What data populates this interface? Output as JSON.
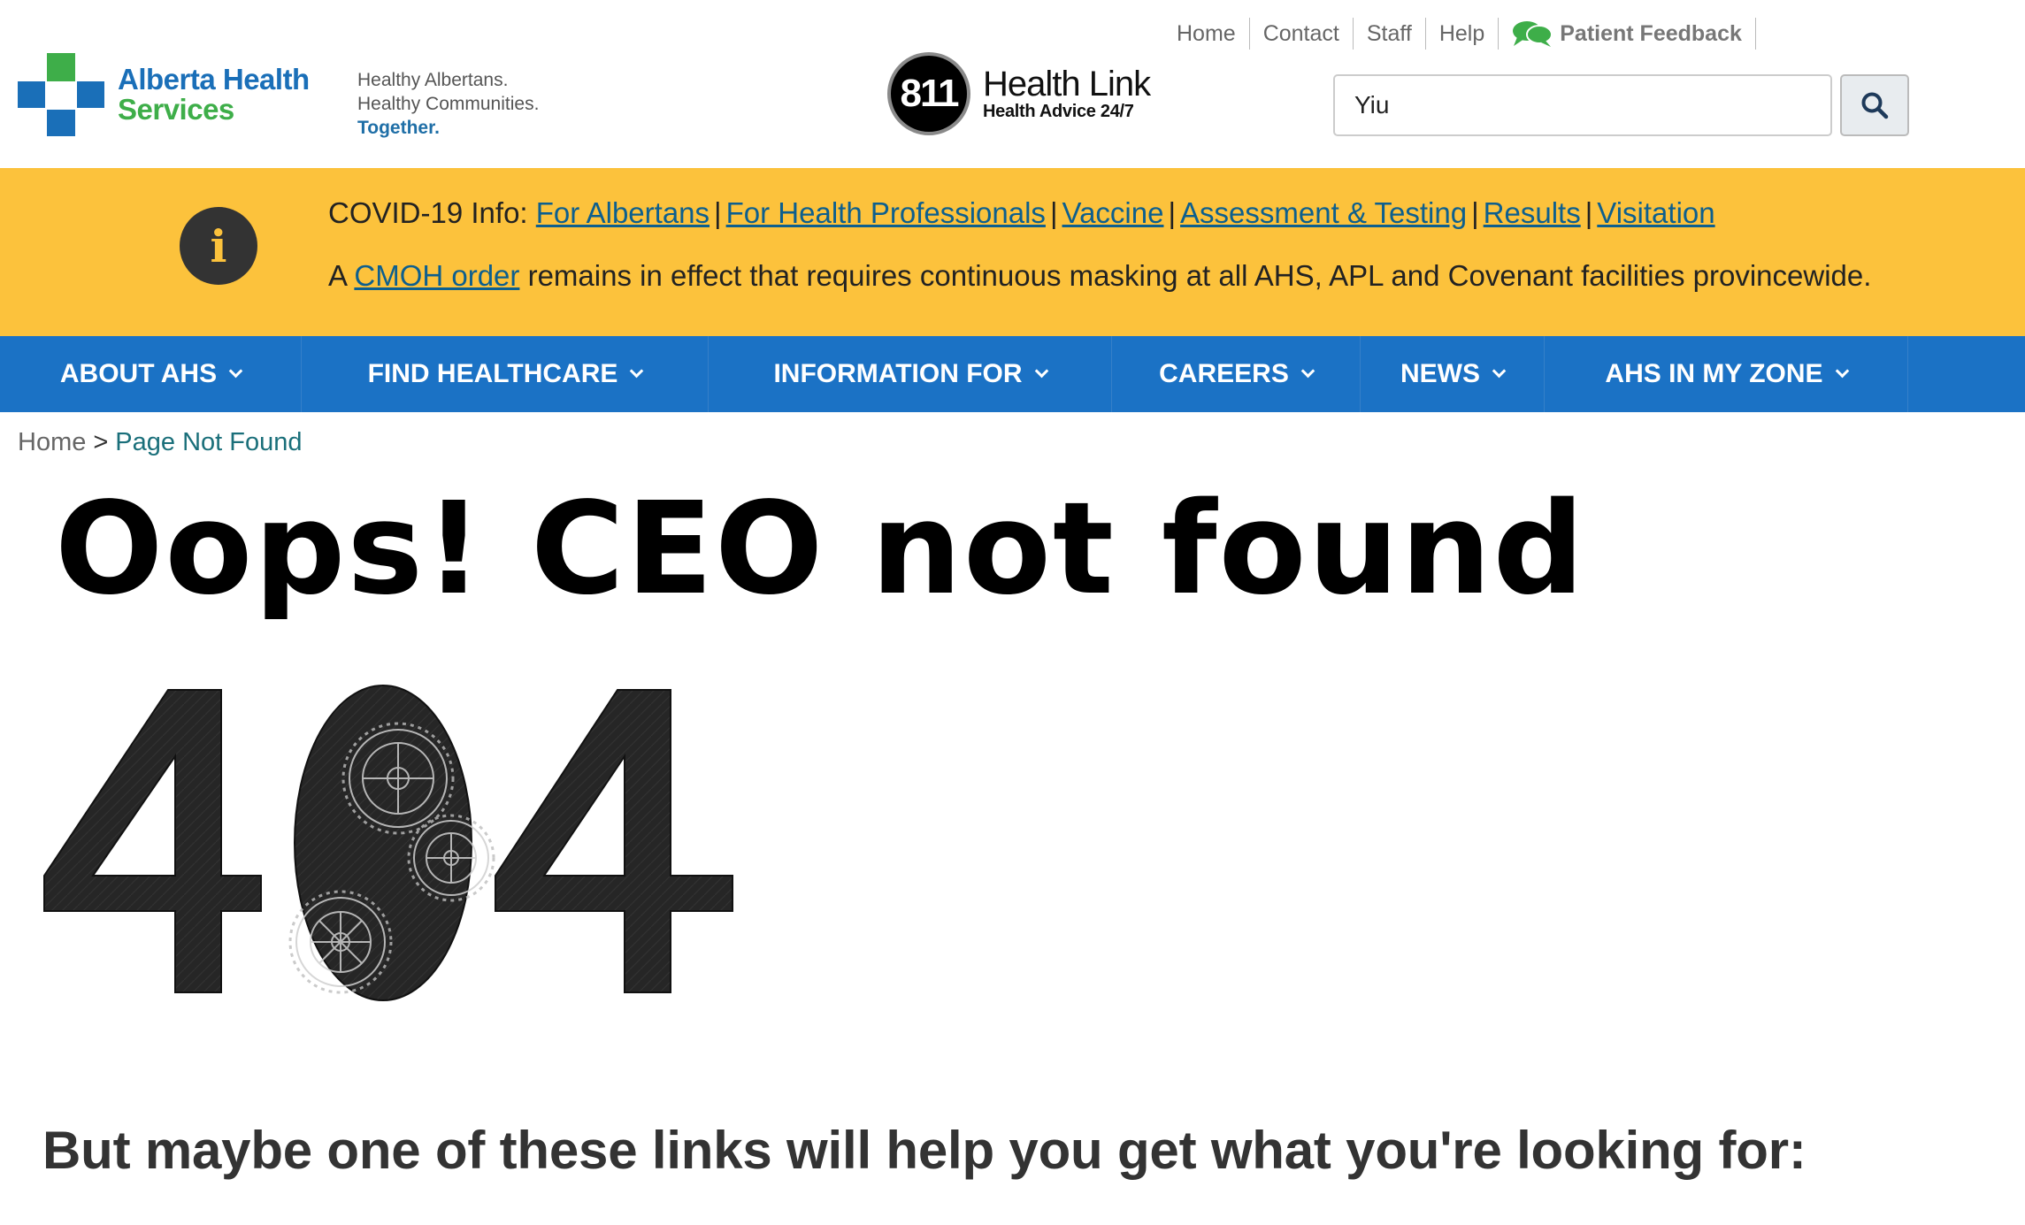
{
  "header": {
    "logo": {
      "line1": "Alberta Health",
      "line2": "Services",
      "icon": "ahs-cross-logo"
    },
    "tagline": {
      "line1": "Healthy Albertans.",
      "line2": "Healthy Communities.",
      "line3": "Together."
    },
    "healthlink": {
      "badge": "811",
      "title": "Health Link",
      "subtitle": "Health Advice 24/7"
    },
    "utility_links": [
      "Home",
      "Contact",
      "Staff",
      "Help"
    ],
    "patient_feedback": "Patient Feedback",
    "search": {
      "value": "Yiu",
      "icon": "search-icon"
    }
  },
  "banner": {
    "icon": "info-icon",
    "line1_prefix": "COVID-19 Info:",
    "links": [
      "For Albertans",
      "For Health Professionals",
      "Vaccine",
      "Assessment & Testing",
      "Results",
      "Visitation"
    ],
    "line2_prefix": "A",
    "line2_link": "CMOH order",
    "line2_suffix": "remains in effect that requires continuous masking at all AHS, APL and Covenant facilities provincewide."
  },
  "nav": {
    "items": [
      "About AHS",
      "Find Healthcare",
      "Information For",
      "Careers",
      "News",
      "AHS in My Zone"
    ]
  },
  "breadcrumb": {
    "home": "Home",
    "separator": ">",
    "current": "Page Not Found"
  },
  "main": {
    "title": "Oops! CEO not found",
    "error_code": "404",
    "subheading": "But maybe one of these links will help you get what you're looking for:"
  },
  "colors": {
    "brand_blue": "#1b72c5",
    "brand_green": "#3eae49",
    "banner_yellow": "#fcc23c",
    "link": "#0d5f8e"
  }
}
